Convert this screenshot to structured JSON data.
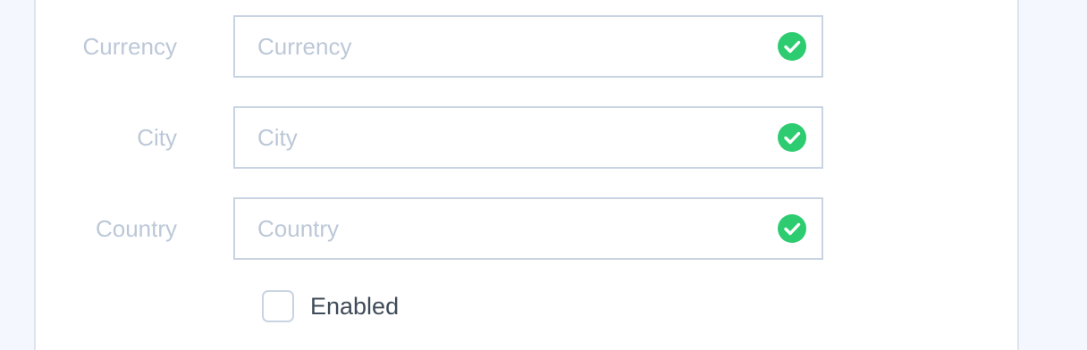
{
  "form": {
    "fields": [
      {
        "label": "Currency",
        "placeholder": "Currency",
        "value": "",
        "status": "valid"
      },
      {
        "label": "City",
        "placeholder": "City",
        "value": "",
        "status": "valid"
      },
      {
        "label": "Country",
        "placeholder": "Country",
        "value": "",
        "status": "valid"
      }
    ],
    "enabled": {
      "label": "Enabled",
      "checked": false
    }
  },
  "colors": {
    "valid": "#2ecc71",
    "field_border": "#c9d4e2",
    "label_text": "#bcc8d8",
    "page_background": "#f4f7fd"
  },
  "icons": {
    "valid": "check-circle-icon"
  }
}
